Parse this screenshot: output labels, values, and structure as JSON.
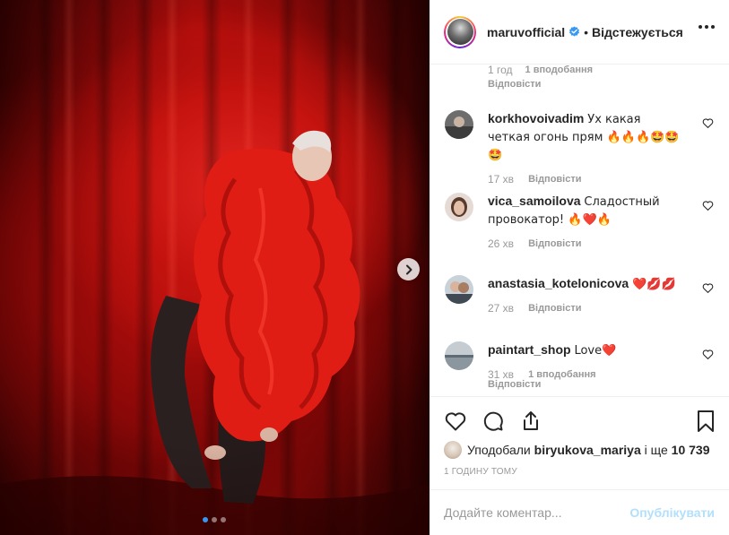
{
  "post": {
    "username": "maruvofficial",
    "follow_state": "Відстежується",
    "separator": "•",
    "carousel": {
      "slides": 3,
      "active_index": 0
    }
  },
  "comments_top": {
    "time": "1 год",
    "likes": "1 вподобання",
    "reply": "Відповісти"
  },
  "comments": [
    {
      "user": "korkhovoivadim",
      "text": "Ух какая четкая огонь прям 🔥🔥🔥🤩🤩🤩",
      "time": "17 хв",
      "reply": "Відповісти"
    },
    {
      "user": "vica_samoilova",
      "text": "Сладостный провокатор! 🔥❤️🔥",
      "time": "26 хв",
      "reply": "Відповісти"
    },
    {
      "user": "anastasia_kotelonicova",
      "text": "❤️💋💋",
      "time": "27 хв",
      "reply": "Відповісти"
    },
    {
      "user": "paintart_shop",
      "text": "Love❤️",
      "time": "31 хв",
      "likes": "1 вподобання",
      "reply": "Відповісти"
    }
  ],
  "likes": {
    "prefix": "Уподобали",
    "user": "biryukova_mariya",
    "suffix": "і ще",
    "count": "10 739"
  },
  "timestamp": "1 годину тому",
  "comment_form": {
    "placeholder": "Додайте коментар...",
    "submit_label": "Опублікувати"
  },
  "colors": {
    "accent_blue": "#3897f0",
    "publish_disabled": "#b2dffc",
    "text": "#262626",
    "muted": "#999999",
    "curtain_red": "#c5130f"
  }
}
